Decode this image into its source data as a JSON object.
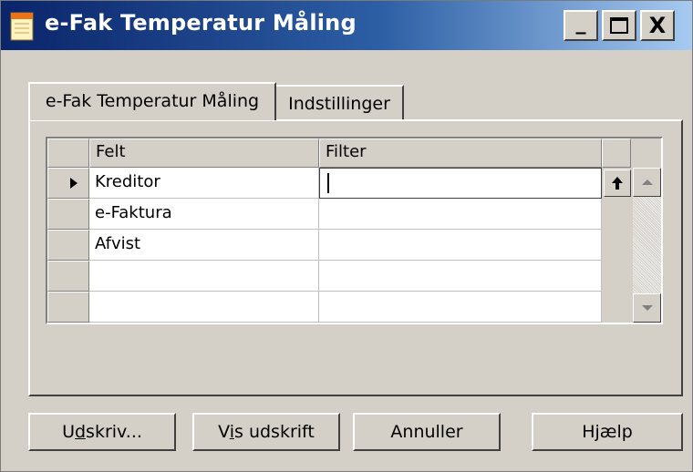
{
  "window": {
    "title": "e-Fak Temperatur Måling",
    "minimize_symbol": "_",
    "close_symbol": "X"
  },
  "tabs": [
    {
      "label": "e-Fak Temperatur Måling",
      "active": true
    },
    {
      "label": "Indstillinger",
      "active": false
    }
  ],
  "grid": {
    "columns": [
      "Felt",
      "Filter"
    ],
    "rows": [
      {
        "felt": "Kreditor",
        "filter": "",
        "current": true
      },
      {
        "felt": "e-Faktura",
        "filter": ""
      },
      {
        "felt": "Afvist",
        "filter": ""
      },
      {
        "felt": "",
        "filter": ""
      },
      {
        "felt": "",
        "filter": ""
      }
    ]
  },
  "buttons": {
    "print": {
      "pre": "U",
      "accel": "d",
      "post": "skriv..."
    },
    "preview": {
      "pre": "V",
      "accel": "i",
      "post": "s udskrift"
    },
    "cancel": "Annuller",
    "help": "Hjælp"
  },
  "icons": [
    "app-notepad-icon",
    "row-pointer-icon",
    "lookup-arrow-icon",
    "scroll-up-icon",
    "scroll-down-icon",
    "maximize-icon"
  ],
  "colors": {
    "titlebar_start": "#0a246a",
    "titlebar_end": "#a6caf0",
    "face": "#d4d0c8"
  }
}
